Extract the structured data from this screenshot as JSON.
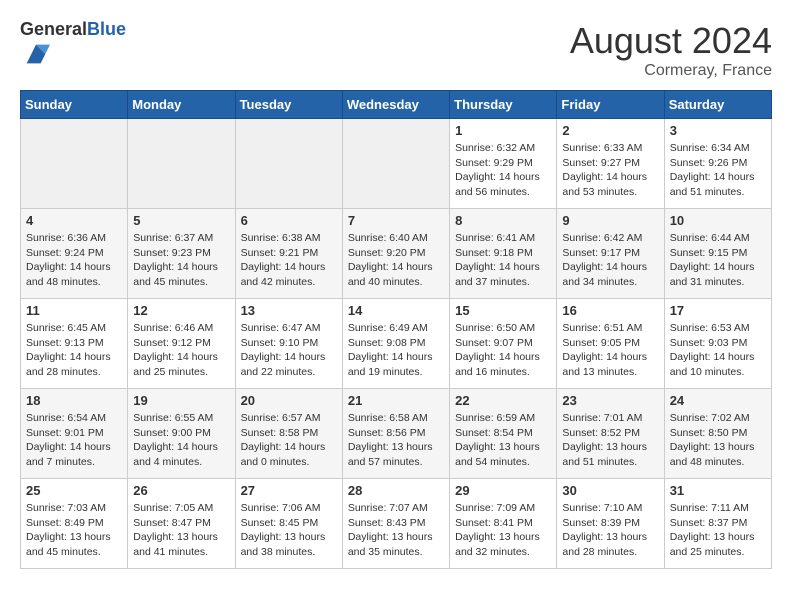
{
  "header": {
    "logo_general": "General",
    "logo_blue": "Blue",
    "month_year": "August 2024",
    "location": "Cormeray, France"
  },
  "days_of_week": [
    "Sunday",
    "Monday",
    "Tuesday",
    "Wednesday",
    "Thursday",
    "Friday",
    "Saturday"
  ],
  "weeks": [
    [
      {
        "day": "",
        "empty": true
      },
      {
        "day": "",
        "empty": true
      },
      {
        "day": "",
        "empty": true
      },
      {
        "day": "",
        "empty": true
      },
      {
        "day": "1",
        "sunrise": "6:32 AM",
        "sunset": "9:29 PM",
        "daylight": "14 hours and 56 minutes."
      },
      {
        "day": "2",
        "sunrise": "6:33 AM",
        "sunset": "9:27 PM",
        "daylight": "14 hours and 53 minutes."
      },
      {
        "day": "3",
        "sunrise": "6:34 AM",
        "sunset": "9:26 PM",
        "daylight": "14 hours and 51 minutes."
      }
    ],
    [
      {
        "day": "4",
        "sunrise": "6:36 AM",
        "sunset": "9:24 PM",
        "daylight": "14 hours and 48 minutes."
      },
      {
        "day": "5",
        "sunrise": "6:37 AM",
        "sunset": "9:23 PM",
        "daylight": "14 hours and 45 minutes."
      },
      {
        "day": "6",
        "sunrise": "6:38 AM",
        "sunset": "9:21 PM",
        "daylight": "14 hours and 42 minutes."
      },
      {
        "day": "7",
        "sunrise": "6:40 AM",
        "sunset": "9:20 PM",
        "daylight": "14 hours and 40 minutes."
      },
      {
        "day": "8",
        "sunrise": "6:41 AM",
        "sunset": "9:18 PM",
        "daylight": "14 hours and 37 minutes."
      },
      {
        "day": "9",
        "sunrise": "6:42 AM",
        "sunset": "9:17 PM",
        "daylight": "14 hours and 34 minutes."
      },
      {
        "day": "10",
        "sunrise": "6:44 AM",
        "sunset": "9:15 PM",
        "daylight": "14 hours and 31 minutes."
      }
    ],
    [
      {
        "day": "11",
        "sunrise": "6:45 AM",
        "sunset": "9:13 PM",
        "daylight": "14 hours and 28 minutes."
      },
      {
        "day": "12",
        "sunrise": "6:46 AM",
        "sunset": "9:12 PM",
        "daylight": "14 hours and 25 minutes."
      },
      {
        "day": "13",
        "sunrise": "6:47 AM",
        "sunset": "9:10 PM",
        "daylight": "14 hours and 22 minutes."
      },
      {
        "day": "14",
        "sunrise": "6:49 AM",
        "sunset": "9:08 PM",
        "daylight": "14 hours and 19 minutes."
      },
      {
        "day": "15",
        "sunrise": "6:50 AM",
        "sunset": "9:07 PM",
        "daylight": "14 hours and 16 minutes."
      },
      {
        "day": "16",
        "sunrise": "6:51 AM",
        "sunset": "9:05 PM",
        "daylight": "14 hours and 13 minutes."
      },
      {
        "day": "17",
        "sunrise": "6:53 AM",
        "sunset": "9:03 PM",
        "daylight": "14 hours and 10 minutes."
      }
    ],
    [
      {
        "day": "18",
        "sunrise": "6:54 AM",
        "sunset": "9:01 PM",
        "daylight": "14 hours and 7 minutes."
      },
      {
        "day": "19",
        "sunrise": "6:55 AM",
        "sunset": "9:00 PM",
        "daylight": "14 hours and 4 minutes."
      },
      {
        "day": "20",
        "sunrise": "6:57 AM",
        "sunset": "8:58 PM",
        "daylight": "14 hours and 0 minutes."
      },
      {
        "day": "21",
        "sunrise": "6:58 AM",
        "sunset": "8:56 PM",
        "daylight": "13 hours and 57 minutes."
      },
      {
        "day": "22",
        "sunrise": "6:59 AM",
        "sunset": "8:54 PM",
        "daylight": "13 hours and 54 minutes."
      },
      {
        "day": "23",
        "sunrise": "7:01 AM",
        "sunset": "8:52 PM",
        "daylight": "13 hours and 51 minutes."
      },
      {
        "day": "24",
        "sunrise": "7:02 AM",
        "sunset": "8:50 PM",
        "daylight": "13 hours and 48 minutes."
      }
    ],
    [
      {
        "day": "25",
        "sunrise": "7:03 AM",
        "sunset": "8:49 PM",
        "daylight": "13 hours and 45 minutes."
      },
      {
        "day": "26",
        "sunrise": "7:05 AM",
        "sunset": "8:47 PM",
        "daylight": "13 hours and 41 minutes."
      },
      {
        "day": "27",
        "sunrise": "7:06 AM",
        "sunset": "8:45 PM",
        "daylight": "13 hours and 38 minutes."
      },
      {
        "day": "28",
        "sunrise": "7:07 AM",
        "sunset": "8:43 PM",
        "daylight": "13 hours and 35 minutes."
      },
      {
        "day": "29",
        "sunrise": "7:09 AM",
        "sunset": "8:41 PM",
        "daylight": "13 hours and 32 minutes."
      },
      {
        "day": "30",
        "sunrise": "7:10 AM",
        "sunset": "8:39 PM",
        "daylight": "13 hours and 28 minutes."
      },
      {
        "day": "31",
        "sunrise": "7:11 AM",
        "sunset": "8:37 PM",
        "daylight": "13 hours and 25 minutes."
      }
    ]
  ],
  "labels": {
    "sunrise_prefix": "Sunrise: ",
    "sunset_prefix": "Sunset: ",
    "daylight_prefix": "Daylight: "
  }
}
